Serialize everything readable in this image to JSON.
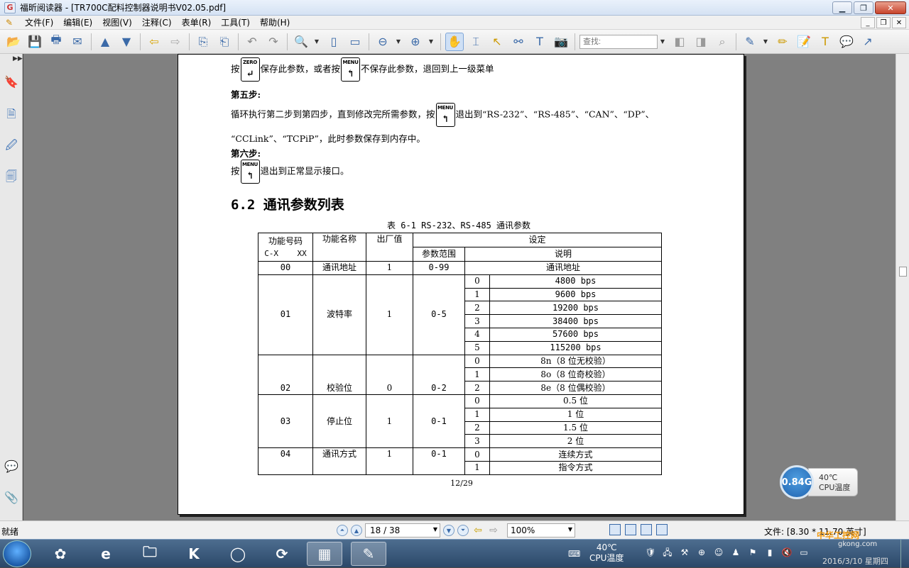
{
  "window": {
    "title": "福昕阅读器 - [TR700C配料控制器说明书V02.05.pdf]"
  },
  "menu": {
    "items": [
      "文件(F)",
      "编辑(E)",
      "视图(V)",
      "注释(C)",
      "表单(R)",
      "工具(T)",
      "帮助(H)"
    ]
  },
  "toolbar": {
    "find_placeholder": "查找:"
  },
  "doc": {
    "line1_a": "按",
    "key_zero": "ZERO",
    "line1_b": "保存此参数，或者按",
    "key_menu": "MENU",
    "line1_c": "不保存此参数，退回到上一级菜单",
    "step5": "第五步:",
    "line2_a": "循环执行第二步到第四步，直到修改完所需参数，按",
    "line2_b": "退出到“RS-232”、“RS-485”、“CAN”、“DP”、",
    "line3": "“CCLink”、“TCPiP”，此时参数保存到内存中。",
    "step6": "第六步:",
    "line4_a": "按",
    "line4_b": "退出到正常显示接口。",
    "heading": "6.2 通讯参数列表",
    "table_caption": "表 6-1 RS-232、RS-485 通讯参数",
    "table": {
      "h_code": "功能号码",
      "h_code2": "C-X    XX",
      "h_name": "功能名称",
      "h_default": "出厂值",
      "h_setting": "设定",
      "h_range": "参数范围",
      "h_desc": "说明",
      "r00": {
        "code": "00",
        "name": "通讯地址",
        "default": "1",
        "range": "0-99",
        "desc": "通讯地址"
      },
      "r01": {
        "code": "01",
        "name": "波特率",
        "default": "1",
        "range": "0-5",
        "opts": [
          [
            "0",
            "4800 bps"
          ],
          [
            "1",
            "9600 bps"
          ],
          [
            "2",
            "19200 bps"
          ],
          [
            "3",
            "38400 bps"
          ],
          [
            "4",
            "57600 bps"
          ],
          [
            "5",
            "115200 bps"
          ]
        ]
      },
      "r02": {
        "code": "02",
        "name": "校验位",
        "default": "0",
        "range": "0-2",
        "opts": [
          [
            "0",
            "8n（8 位无校验）"
          ],
          [
            "1",
            "8o（8 位奇校验）"
          ],
          [
            "2",
            "8e（8 位偶校验）"
          ]
        ]
      },
      "r03": {
        "code": "03",
        "name": "停止位",
        "default": "1",
        "range": "0-1",
        "opts": [
          [
            "0",
            "0.5 位"
          ],
          [
            "1",
            "1 位"
          ],
          [
            "2",
            "1.5 位"
          ],
          [
            "3",
            "2 位"
          ]
        ]
      },
      "r04": {
        "code": "04",
        "name": "通讯方式",
        "default": "1",
        "range": "0-1",
        "opts": [
          [
            "0",
            "连续方式"
          ],
          [
            "1",
            "指令方式"
          ]
        ]
      }
    },
    "page_number": "12/29"
  },
  "status": {
    "ready": "就绪",
    "page": "18 / 38",
    "zoom": "100%",
    "file_size": "文件: [8.30 * 11.70 英寸]"
  },
  "widget": {
    "load": "0.84G",
    "temp": "40℃",
    "temp_label": "CPU温度"
  },
  "taskbar": {
    "temp": "40℃",
    "temp_label": "CPU温度",
    "clock": "2016/3/10 星期四"
  },
  "watermark": {
    "brand": "中华工控网",
    "url": "gkong.com"
  }
}
